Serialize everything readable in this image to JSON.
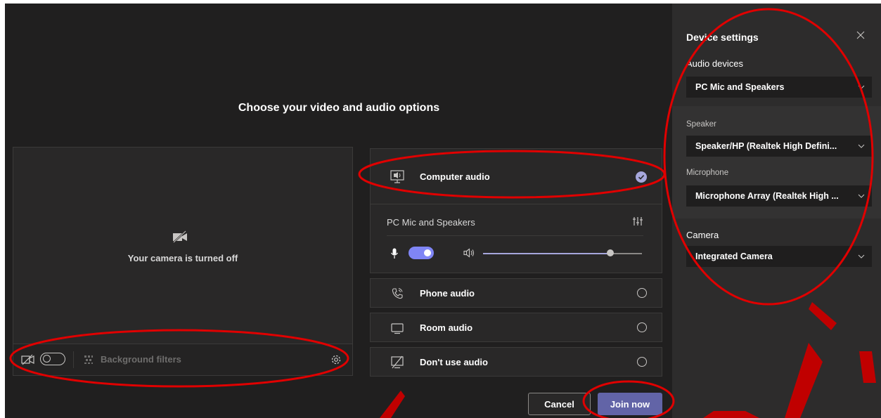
{
  "main": {
    "title": "Choose your video and audio options"
  },
  "camera": {
    "off_text": "Your camera is turned off",
    "background_filters_label": "Background filters"
  },
  "audio_options": {
    "computer_audio": "Computer audio",
    "pc_device_label": "PC Mic and Speakers",
    "volume_fraction": 0.8,
    "phone_audio": "Phone audio",
    "room_audio": "Room audio",
    "dont_use_audio": "Don't use audio"
  },
  "actions": {
    "cancel": "Cancel",
    "join_now": "Join now"
  },
  "device_settings": {
    "title": "Device settings",
    "audio_devices_label": "Audio devices",
    "audio_devices_value": "PC Mic and Speakers",
    "speaker_label": "Speaker",
    "speaker_value": "Speaker/HP (Realtek High Defini...",
    "microphone_label": "Microphone",
    "microphone_value": "Microphone Array (Realtek High ...",
    "camera_label": "Camera",
    "camera_value": "Integrated Camera"
  },
  "colors": {
    "background": "#201f1f",
    "panel": "#2d2c2c",
    "accent": "#6264a7",
    "annotation": "#e00000"
  }
}
